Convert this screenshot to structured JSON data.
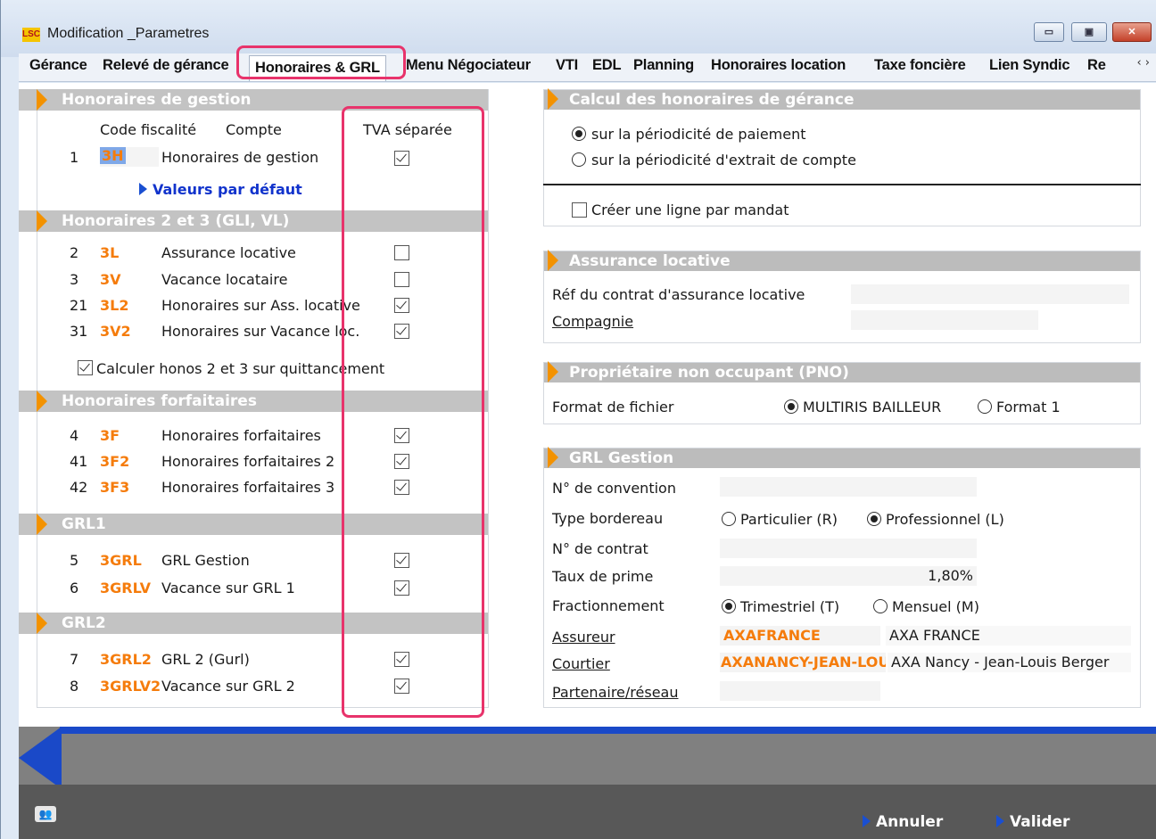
{
  "window": {
    "logo": "LSC",
    "title": "Modification _Parametres",
    "minimize": "▭",
    "maximize": "▣",
    "close": "✕"
  },
  "tabs": [
    "Gérance",
    "Relevé de gérance",
    "Honoraires & GRL",
    "Menu Négociateur",
    "VTI",
    "EDL",
    "Planning",
    "Honoraires location",
    "Taxe foncière",
    "Lien Syndic",
    "Re"
  ],
  "tab_arrows": "‹ ›",
  "left": {
    "gestion": {
      "title": "Honoraires de gestion",
      "col_code": "Code fiscalité",
      "col_compte": "Compte",
      "col_tva": "TVA séparée",
      "row": {
        "num": "1",
        "code": "3H",
        "label": "Honoraires de gestion",
        "tva": true
      },
      "defaults_link": "Valeurs par défaut"
    },
    "h23": {
      "title": "Honoraires 2 et 3 (GLI, VL)",
      "rows": [
        {
          "num": "2",
          "code": "3L",
          "label": "Assurance locative",
          "tva": false
        },
        {
          "num": "3",
          "code": "3V",
          "label": "Vacance locataire",
          "tva": false
        },
        {
          "num": "21",
          "code": "3L2",
          "label": "Honoraires sur Ass. locative",
          "tva": true
        },
        {
          "num": "31",
          "code": "3V2",
          "label": "Honoraires sur Vacance loc.",
          "tva": true
        }
      ],
      "calc_label": "Calculer honos 2 et 3 sur quittancement",
      "calc_checked": true
    },
    "forfait": {
      "title": "Honoraires forfaitaires",
      "rows": [
        {
          "num": "4",
          "code": "3F",
          "label": "Honoraires forfaitaires",
          "tva": true
        },
        {
          "num": "41",
          "code": "3F2",
          "label": "Honoraires forfaitaires 2",
          "tva": true
        },
        {
          "num": "42",
          "code": "3F3",
          "label": "Honoraires forfaitaires 3",
          "tva": true
        }
      ]
    },
    "grl1": {
      "title": "GRL1",
      "rows": [
        {
          "num": "5",
          "code": "3GRL",
          "label": "GRL Gestion",
          "tva": true
        },
        {
          "num": "6",
          "code": "3GRLV",
          "label": "Vacance sur GRL 1",
          "tva": true
        }
      ]
    },
    "grl2": {
      "title": "GRL2",
      "rows": [
        {
          "num": "7",
          "code": "3GRL2",
          "label": "GRL 2 (Gurl)",
          "tva": true
        },
        {
          "num": "8",
          "code": "3GRLV2",
          "label": "Vacance sur GRL 2",
          "tva": true
        }
      ]
    }
  },
  "right": {
    "calcul": {
      "title": "Calcul des honoraires de gérance",
      "opt1": "sur la périodicité de paiement",
      "opt2": "sur la périodicité d'extrait de compte",
      "selected": 1,
      "ligne_label": "Créer une ligne par mandat",
      "ligne_checked": false
    },
    "assurance": {
      "title": "Assurance locative",
      "ref_label": "Réf du contrat d'assurance locative",
      "ref_value": "",
      "compagnie_label": "Compagnie",
      "compagnie_value": ""
    },
    "pno": {
      "title": "Propriétaire non occupant (PNO)",
      "format_label": "Format de fichier",
      "opt1": "MULTIRIS BAILLEUR",
      "opt2": "Format 1",
      "selected": 1
    },
    "grl": {
      "title": "GRL Gestion",
      "convention_label": "N° de convention",
      "convention_value": "",
      "bordereau_label": "Type bordereau",
      "bord_opt1": "Particulier (R)",
      "bord_opt2": "Professionnel (L)",
      "bord_selected": 2,
      "contrat_label": "N° de contrat",
      "contrat_value": "",
      "taux_label": "Taux de prime",
      "taux_value": "1,80%",
      "fraction_label": "Fractionnement",
      "frac_opt1": "Trimestriel (T)",
      "frac_opt2": "Mensuel (M)",
      "frac_selected": 1,
      "assureur_label": "Assureur",
      "assureur_code": "AXAFRANCE",
      "assureur_name": "AXA FRANCE",
      "courtier_label": "Courtier",
      "courtier_code": "AXANANCY-JEAN-LOUIS",
      "courtier_name": "AXA Nancy - Jean-Louis Berger",
      "partenaire_label": "Partenaire/réseau",
      "partenaire_value": ""
    }
  },
  "footer": {
    "cancel": "Annuler",
    "validate": "Valider",
    "users_icon": "👥"
  }
}
